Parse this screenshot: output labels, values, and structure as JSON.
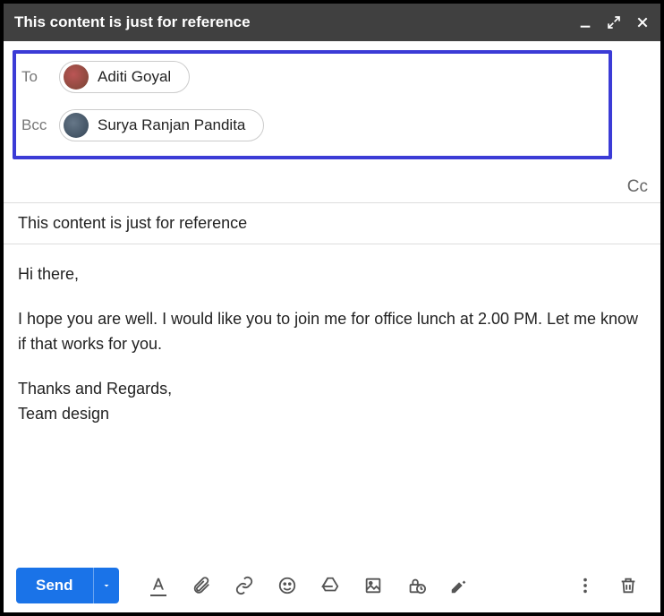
{
  "window": {
    "title": "This content is just for reference"
  },
  "recipients": {
    "to_label": "To",
    "to_name": "Aditi Goyal",
    "bcc_label": "Bcc",
    "bcc_name": "Surya Ranjan Pandita",
    "cc_label": "Cc"
  },
  "subject": "This content is just for reference",
  "body": {
    "greeting": "Hi there,",
    "paragraph": "I hope you are well. I would like you to join me for office lunch at 2.00 PM. Let me know if that works for you.",
    "signoff1": "Thanks and Regards,",
    "signoff2": "Team design"
  },
  "toolbar": {
    "send": "Send"
  }
}
